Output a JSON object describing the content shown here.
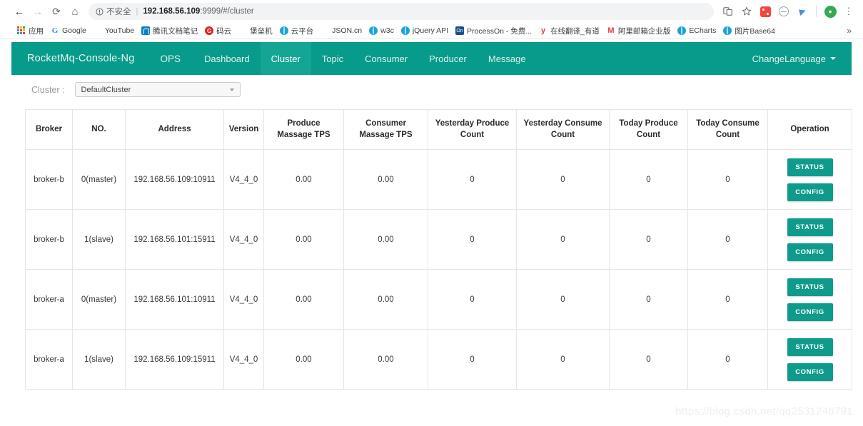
{
  "browser": {
    "nav": {
      "back": "←",
      "forward": "→",
      "reload": "⟳",
      "home": "⌂"
    },
    "omnibox": {
      "security_label": "不安全",
      "separator": "|",
      "host": "192.168.56.109",
      "path": ":9999/#/cluster",
      "full_url": "192.168.56.109:9999/#/cluster"
    },
    "toolbar_icons": [
      {
        "name": "reading-list-icon",
        "glyph": "❐"
      },
      {
        "name": "bookmark-star-icon",
        "glyph": "☆"
      },
      {
        "name": "extension-dice-icon",
        "glyph": ""
      },
      {
        "name": "extension-circle-icon",
        "glyph": ""
      },
      {
        "name": "extension-bird-icon",
        "glyph": ""
      },
      {
        "name": "profile-avatar",
        "glyph": "●"
      },
      {
        "name": "chrome-menu-icon",
        "glyph": "⋮"
      }
    ],
    "bookmarks": [
      {
        "label": "应用",
        "icon": "apps-grid-icon"
      },
      {
        "label": "Google",
        "icon": "google-icon"
      },
      {
        "label": "YouTube",
        "icon": "youtube-icon"
      },
      {
        "label": "腾讯文档笔记",
        "icon": "tencent-docs-icon"
      },
      {
        "label": "码云",
        "icon": "gitee-icon"
      },
      {
        "label": "堡垒机",
        "icon": "shield-icon"
      },
      {
        "label": "云平台",
        "icon": "globe-icon"
      },
      {
        "label": "JSON.cn",
        "icon": "json-icon"
      },
      {
        "label": "w3c",
        "icon": "globe-icon"
      },
      {
        "label": "jQuery API",
        "icon": "globe-icon"
      },
      {
        "label": "ProcessOn - 免费...",
        "icon": "processon-icon"
      },
      {
        "label": "在线翻译_有道",
        "icon": "youdao-icon"
      },
      {
        "label": "阿里邮箱企业版",
        "icon": "alimail-icon"
      },
      {
        "label": "ECharts",
        "icon": "globe-icon"
      },
      {
        "label": "图片Base64",
        "icon": "globe-icon"
      }
    ],
    "bookmarks_overflow": "»"
  },
  "app": {
    "brand": "RocketMq-Console-Ng",
    "nav_items": [
      {
        "label": "OPS",
        "active": false
      },
      {
        "label": "Dashboard",
        "active": false
      },
      {
        "label": "Cluster",
        "active": true
      },
      {
        "label": "Topic",
        "active": false
      },
      {
        "label": "Consumer",
        "active": false
      },
      {
        "label": "Producer",
        "active": false
      },
      {
        "label": "Message",
        "active": false
      }
    ],
    "change_language": "ChangeLanguage",
    "accent_color": "#089a8a",
    "accent_active_color": "#15a594",
    "button_color": "#0f9b8b"
  },
  "cluster_selector": {
    "label": "Cluster :",
    "value": "DefaultCluster",
    "options": [
      "DefaultCluster"
    ]
  },
  "table": {
    "headers": [
      "Broker",
      "NO.",
      "Address",
      "Version",
      "Produce\nMassage TPS",
      "Consumer\nMassage TPS",
      "Yesterday Produce\nCount",
      "Yesterday Consume\nCount",
      "Today Produce\nCount",
      "Today Consume\nCount",
      "Operation"
    ],
    "headers_flat": {
      "broker": "Broker",
      "no": "NO.",
      "address": "Address",
      "version": "Version",
      "produce_tps_l1": "Produce",
      "produce_tps_l2": "Massage TPS",
      "consume_tps_l1": "Consumer",
      "consume_tps_l2": "Massage TPS",
      "y_produce_l1": "Yesterday Produce",
      "y_produce_l2": "Count",
      "y_consume_l1": "Yesterday Consume",
      "y_consume_l2": "Count",
      "t_produce_l1": "Today Produce",
      "t_produce_l2": "Count",
      "t_consume_l1": "Today Consume",
      "t_consume_l2": "Count",
      "operation": "Operation"
    },
    "op_buttons": {
      "status": "STATUS",
      "config": "CONFIG"
    },
    "rows": [
      {
        "broker": "broker-b",
        "no": "0(master)",
        "address": "192.168.56.109:10911",
        "version": "V4_4_0",
        "produce_tps": "0.00",
        "consume_tps": "0.00",
        "yesterday_produce": "0",
        "yesterday_consume": "0",
        "today_produce": "0",
        "today_consume": "0"
      },
      {
        "broker": "broker-b",
        "no": "1(slave)",
        "address": "192.168.56.101:15911",
        "version": "V4_4_0",
        "produce_tps": "0.00",
        "consume_tps": "0.00",
        "yesterday_produce": "0",
        "yesterday_consume": "0",
        "today_produce": "0",
        "today_consume": "0"
      },
      {
        "broker": "broker-a",
        "no": "0(master)",
        "address": "192.168.56.101:10911",
        "version": "V4_4_0",
        "produce_tps": "0.00",
        "consume_tps": "0.00",
        "yesterday_produce": "0",
        "yesterday_consume": "0",
        "today_produce": "0",
        "today_consume": "0"
      },
      {
        "broker": "broker-a",
        "no": "1(slave)",
        "address": "192.168.56.109:15911",
        "version": "V4_4_0",
        "produce_tps": "0.00",
        "consume_tps": "0.00",
        "yesterday_produce": "0",
        "yesterday_consume": "0",
        "today_produce": "0",
        "today_consume": "0"
      }
    ]
  },
  "watermark": "https://blog.csdn.net/qq2531246791"
}
